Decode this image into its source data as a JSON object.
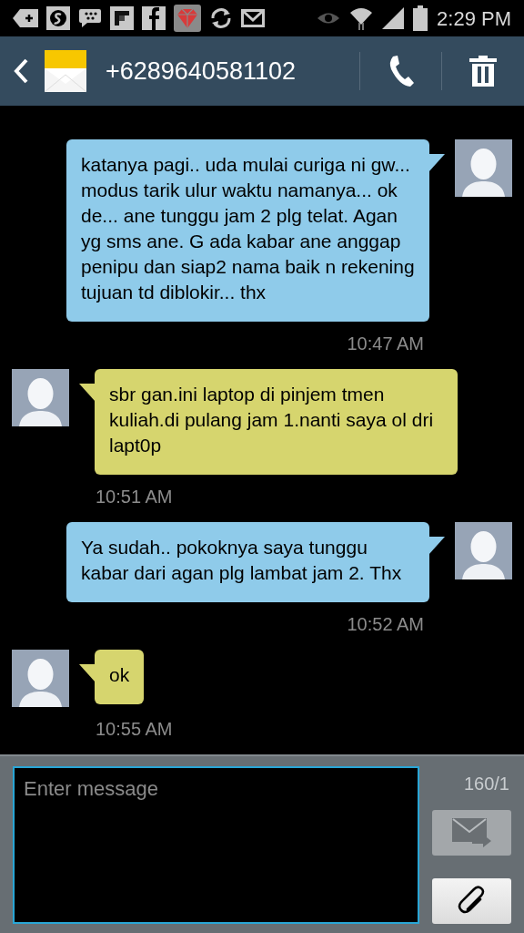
{
  "status_bar": {
    "time": "2:29 PM"
  },
  "header": {
    "title": "+6289640581102"
  },
  "messages": [
    {
      "kind": "sent",
      "text": "katanya pagi.. uda mulai curiga ni gw... modus tarik ulur waktu namanya... ok de... ane tunggu jam 2 plg telat. Agan yg sms ane. G ada kabar ane anggap penipu dan siap2 nama baik n rekening tujuan td diblokir... thx",
      "time": "10:47 AM"
    },
    {
      "kind": "received",
      "text": "sbr gan.ini laptop di pinjem tmen kuliah.di pulang jam 1.nanti saya ol dri lapt0p",
      "time": "10:51 AM"
    },
    {
      "kind": "sent",
      "text": "Ya sudah.. pokoknya saya tunggu kabar dari agan plg lambat jam 2. Thx",
      "time": "10:52 AM"
    },
    {
      "kind": "received",
      "text": "ok",
      "time": "10:55 AM"
    }
  ],
  "composer": {
    "placeholder": "Enter message",
    "counter": "160/1",
    "send_disabled": true
  }
}
